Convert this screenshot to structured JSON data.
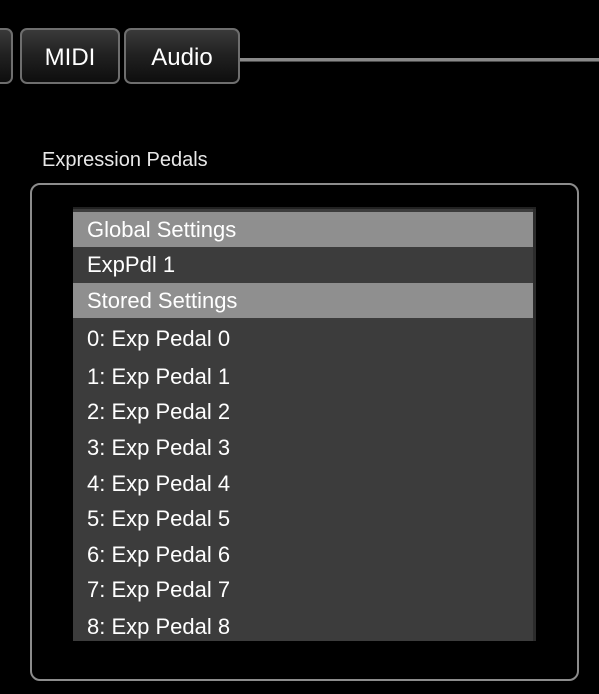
{
  "tabs": [
    {
      "label": ""
    },
    {
      "label": "MIDI"
    },
    {
      "label": "Audio"
    }
  ],
  "expression_pedals": {
    "title": "Expression Pedals",
    "list": [
      {
        "label": "Global Settings",
        "kind": "header"
      },
      {
        "label": "ExpPdl 1",
        "kind": "item"
      },
      {
        "label": "Stored Settings",
        "kind": "header"
      },
      {
        "label": "0: Exp Pedal 0",
        "kind": "item"
      },
      {
        "label": "1: Exp Pedal 1",
        "kind": "item"
      },
      {
        "label": "2: Exp Pedal 2",
        "kind": "item"
      },
      {
        "label": "3: Exp Pedal 3",
        "kind": "item"
      },
      {
        "label": "4: Exp Pedal 4",
        "kind": "item"
      },
      {
        "label": "5: Exp Pedal 5",
        "kind": "item"
      },
      {
        "label": "6: Exp Pedal 6",
        "kind": "item"
      },
      {
        "label": "7: Exp Pedal 7",
        "kind": "item"
      },
      {
        "label": "8: Exp Pedal 8",
        "kind": "item"
      }
    ]
  },
  "colors": {
    "background": "#000000",
    "list_background": "#3c3c3c",
    "list_header": "#8f8f8f",
    "border": "#8c8c8c",
    "text": "#ffffff"
  }
}
